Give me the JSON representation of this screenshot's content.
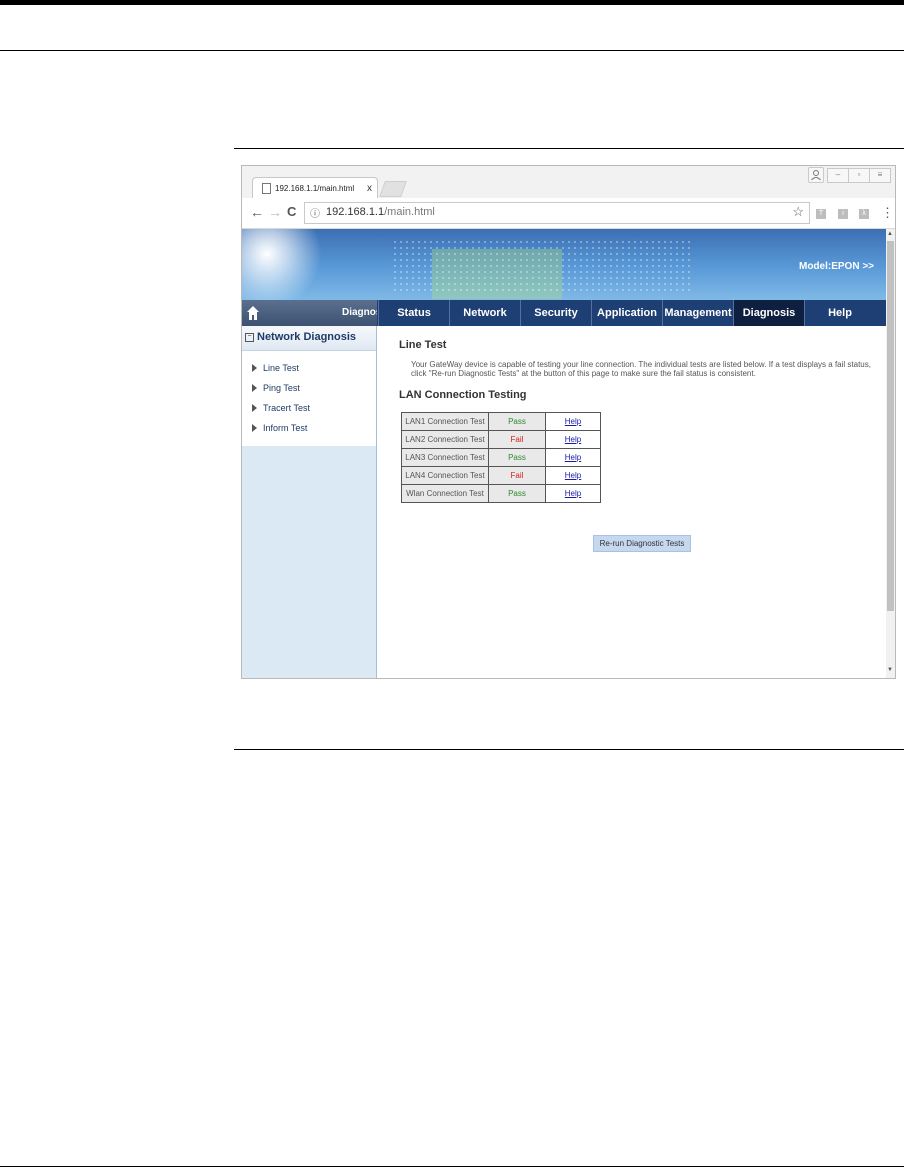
{
  "browser": {
    "tab_title": "192.168.1.1/main.html",
    "tab_close": "x",
    "url_host": "192.168.1.1",
    "url_path": "/main.html",
    "info_icon": "info-icon",
    "star_icon": "star-icon",
    "back_glyph": "←",
    "forward_glyph": "→",
    "reload_glyph": "C",
    "menu_glyph": "⋮",
    "win_minimize": "–",
    "win_maximize": "▫",
    "win_close": "≡",
    "ext_labels": [
      "T",
      "i",
      "λ"
    ],
    "scroll_up": "▲",
    "scroll_down": "▼"
  },
  "banner": {
    "model": "Model:EPON  >>"
  },
  "nav": {
    "home_label": "Diagnos",
    "items": [
      "Status",
      "Network",
      "Security",
      "Application",
      "Management",
      "Diagnosis",
      "Help"
    ],
    "active": "Diagnosis"
  },
  "sidebar": {
    "toggle": "−",
    "heading": "Network Diagnosis",
    "items": [
      "Line Test",
      "Ping Test",
      "Tracert Test",
      "Inform Test"
    ]
  },
  "content": {
    "title": "Line Test",
    "description": "Your GateWay device is capable of testing your line connection. The individual tests are listed below. If a test displays a fail status, click \"Re-run Diagnostic Tests\" at the button of this page to make sure the fail status is consistent.",
    "lan_title": "LAN Connection Testing",
    "rows": [
      {
        "name": "LAN1 Connection Test",
        "result": "Pass",
        "help": "Help"
      },
      {
        "name": "LAN2 Connection Test",
        "result": "Fail",
        "help": "Help"
      },
      {
        "name": "LAN3 Connection Test",
        "result": "Pass",
        "help": "Help"
      },
      {
        "name": "LAN4 Connection Test",
        "result": "Fail",
        "help": "Help"
      },
      {
        "name": "Wlan Connection Test",
        "result": "Pass",
        "help": "Help"
      }
    ],
    "rerun_label": "Re-run Diagnostic Tests"
  },
  "colors": {
    "pass": "#2a8a2a",
    "fail": "#d62020",
    "nav_bg": "#1e3f73",
    "nav_active": "#0e1f3f"
  }
}
